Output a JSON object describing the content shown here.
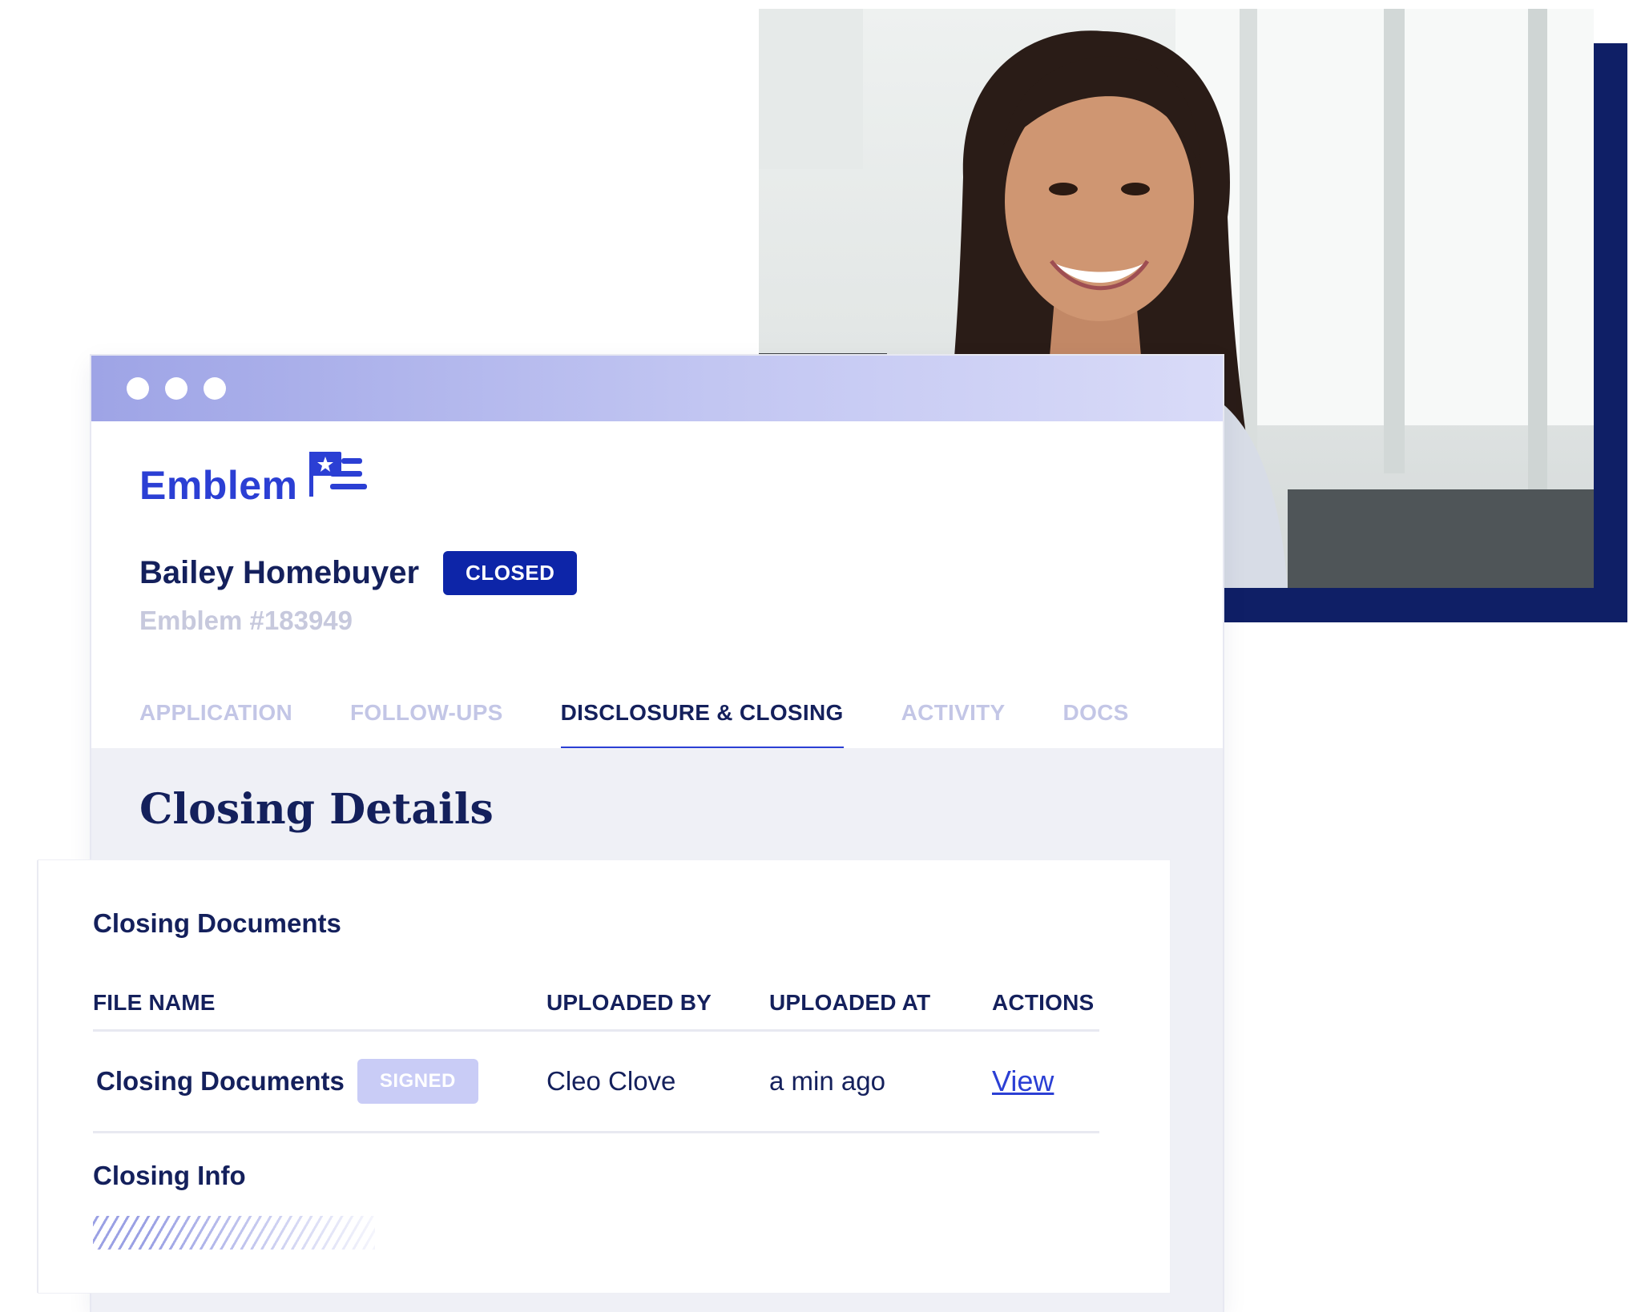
{
  "app": {
    "brand_name": "Emblem",
    "brand_icon": "flag-logo-icon"
  },
  "window": {
    "controls": [
      "dot",
      "dot",
      "dot"
    ]
  },
  "loan": {
    "buyer_name": "Bailey Homebuyer",
    "status": "CLOSED",
    "loan_number": "Emblem #183949"
  },
  "tabs": [
    {
      "label": "APPLICATION",
      "active": false
    },
    {
      "label": "FOLLOW-UPS",
      "active": false
    },
    {
      "label": "DISCLOSURE & CLOSING",
      "active": true
    },
    {
      "label": "ACTIVITY",
      "active": false
    },
    {
      "label": "DOCS",
      "active": false
    }
  ],
  "main": {
    "section_title": "Closing Details"
  },
  "documents": {
    "title": "Closing Documents",
    "columns": [
      "FILE NAME",
      "UPLOADED BY",
      "UPLOADED AT",
      "ACTIONS"
    ],
    "rows": [
      {
        "file_name": "Closing Documents",
        "badge": "SIGNED",
        "uploaded_by": "Cleo Clove",
        "uploaded_at": "a min ago",
        "action": "View"
      }
    ]
  },
  "closing_info": {
    "title": "Closing Info"
  },
  "colors": {
    "navy": "#14205c",
    "brand_blue": "#2b3fd4",
    "badge_closed": "#0d25a8",
    "badge_signed": "#c9ccf6",
    "photo_frame": "#0f1f66",
    "content_bg": "#eff0f6"
  }
}
